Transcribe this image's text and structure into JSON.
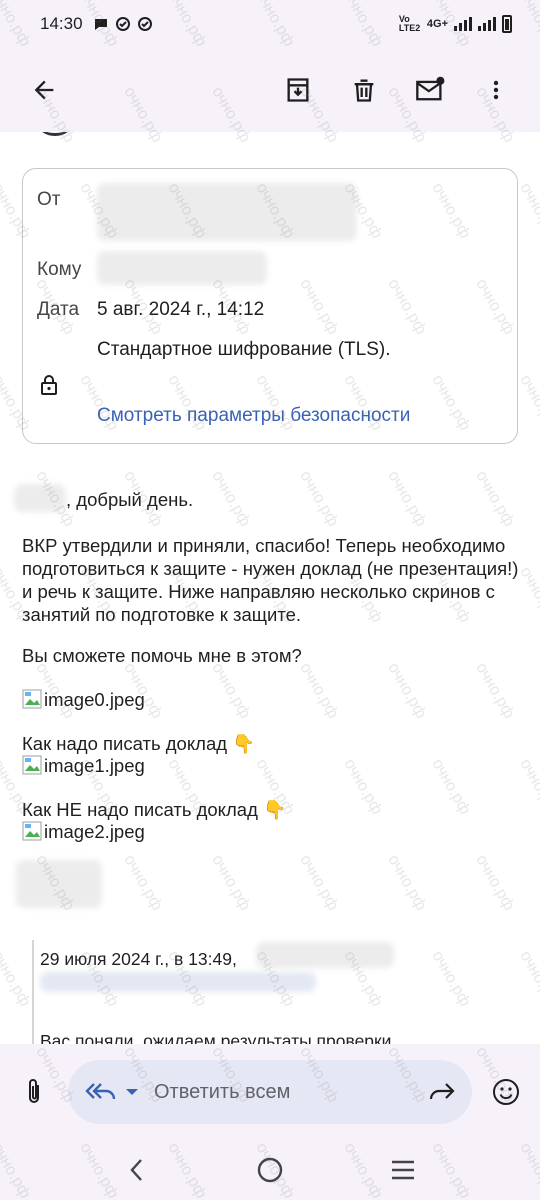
{
  "status": {
    "time": "14:30",
    "network": "4G+",
    "volte": "Vo LTE2"
  },
  "app_bar": {
    "back_icon": "arrow-left-icon",
    "archive_icon": "archive-icon",
    "delete_icon": "trash-icon",
    "mark_unread_icon": "mail-unread-icon",
    "more_icon": "more-vert-icon"
  },
  "details": {
    "from_label": "От",
    "to_label": "Кому",
    "date_label": "Дата",
    "date_value": "5 авг. 2024 г., 14:12",
    "encryption": "Стандартное шифрование (TLS).",
    "security_link": "Смотреть параметры безопасности"
  },
  "body": {
    "greeting": ", добрый день.",
    "paragraph": "ВКР утвердили и приняли, спасибо! Теперь необходимо подготовиться к защите - нужен доклад (не презентация!) и речь к защите. Ниже направляю несколько скринов с занятий по подготовке к защите.",
    "question": "Вы сможете помочь мне в этом?",
    "image0": "image0.jpeg",
    "how_to": "Как надо писать доклад 👇",
    "image1": "image1.jpeg",
    "how_not_to": "Как НЕ надо писать доклад 👇",
    "image2": "image2.jpeg",
    "quote_header": "29 июля 2024 г., в 13:49,",
    "quote_text": "Вас поняли, ожидаем результаты проверки"
  },
  "reply": {
    "label": "Ответить всем"
  },
  "watermark": "очно.рф",
  "colors": {
    "link": "#3a62b4",
    "reply_pill": "#e6e7f5",
    "background": "#f7f2fa"
  }
}
